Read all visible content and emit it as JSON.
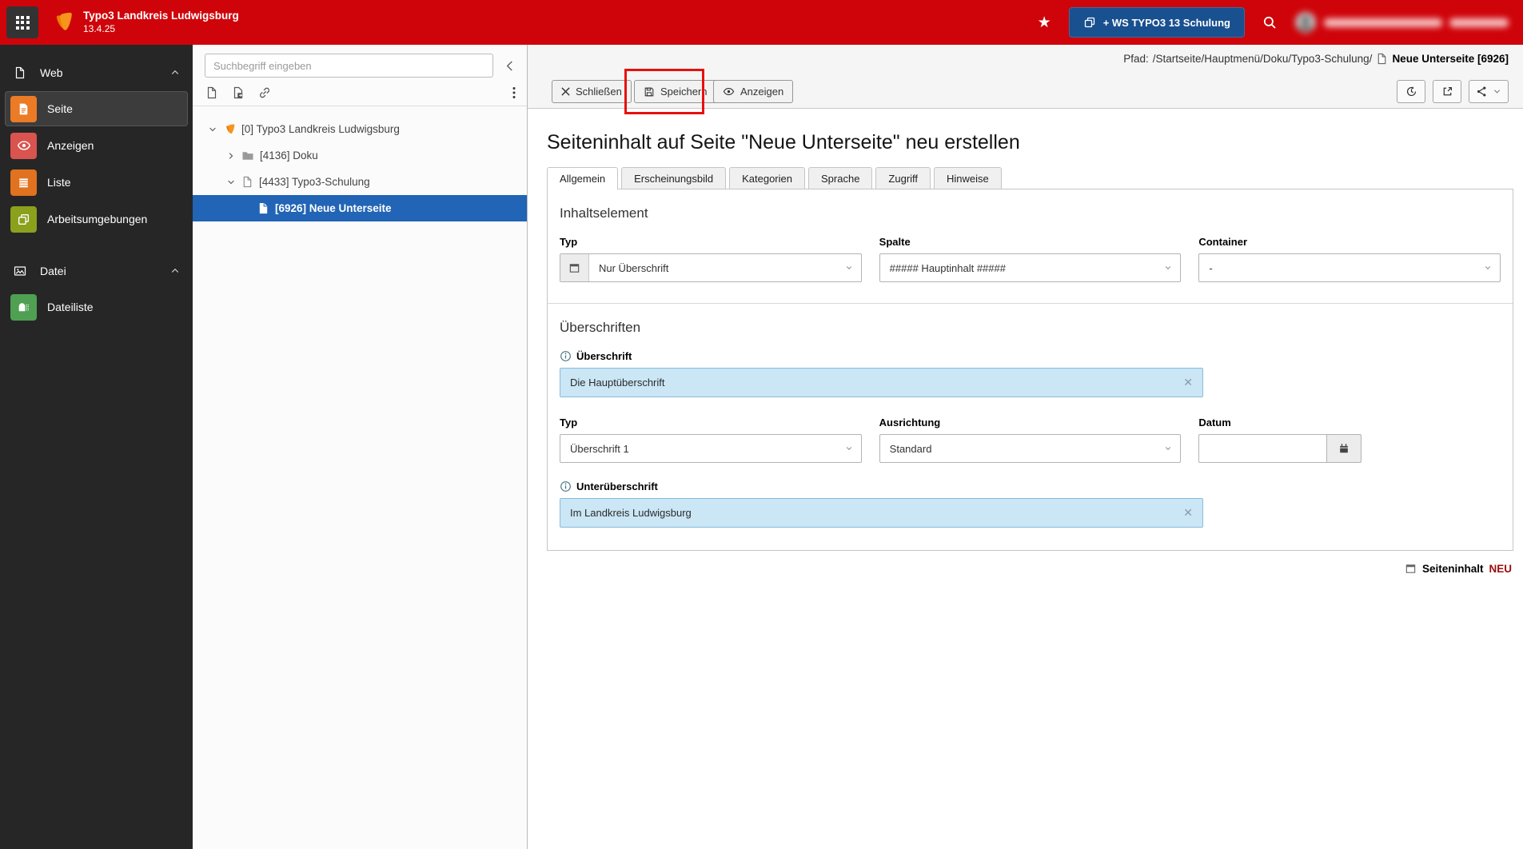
{
  "colors": {
    "topbar_red": "#cf040a",
    "workspace_button_blue": "#19508f",
    "tree_selection_blue": "#2264b5",
    "annotation_red": "#e8100c",
    "highlight_input_blue": "#cbe6f5",
    "badge_new_red": "#9b0c0c",
    "tile_orange": "#ec7b25",
    "tile_red": "#d9534f",
    "tile_olive": "#8ba01c",
    "tile_green": "#4fa052"
  },
  "topbar": {
    "app_title": "Typo3 Landkreis Ludwigsburg",
    "version": "13.4.25",
    "workspace_button_label": "+ WS TYPO3 13 Schulung"
  },
  "module_menu": {
    "sections": [
      {
        "label": "Web",
        "items": [
          {
            "label": "Seite"
          },
          {
            "label": "Anzeigen"
          },
          {
            "label": "Liste"
          },
          {
            "label": "Arbeitsumgebungen"
          }
        ]
      },
      {
        "label": "Datei",
        "items": [
          {
            "label": "Dateiliste"
          }
        ]
      }
    ]
  },
  "page_tree": {
    "search_placeholder": "Suchbegriff eingeben",
    "nodes": [
      {
        "label": "[0] Typo3 Landkreis Ludwigsburg"
      },
      {
        "label": "[4136] Doku"
      },
      {
        "label": "[4433] Typo3-Schulung"
      },
      {
        "label": "[6926] Neue Unterseite"
      }
    ]
  },
  "docheader": {
    "path_label": "Pfad:",
    "path_value": "/Startseite/Hauptmenü/Doku/Typo3-Schulung/",
    "record_title": "Neue Unterseite [6926]",
    "close_label": "Schließen",
    "save_label": "Speichern",
    "view_label": "Anzeigen"
  },
  "content": {
    "page_title": "Seiteninhalt auf Seite \"Neue Unterseite\" neu erstellen",
    "tabs": [
      {
        "label": "Allgemein"
      },
      {
        "label": "Erscheinungsbild"
      },
      {
        "label": "Kategorien"
      },
      {
        "label": "Sprache"
      },
      {
        "label": "Zugriff"
      },
      {
        "label": "Hinweise"
      }
    ],
    "inhaltselement": {
      "section_label": "Inhaltselement",
      "typ_label": "Typ",
      "typ_value": "Nur Überschrift",
      "spalte_label": "Spalte",
      "spalte_value": "##### Hauptinhalt #####",
      "container_label": "Container",
      "container_value": "-"
    },
    "ueberschriften": {
      "section_label": "Überschriften",
      "ueberschrift_label": "Überschrift",
      "ueberschrift_value": "Die Hauptüberschrift",
      "typ_label": "Typ",
      "typ_value": "Überschrift 1",
      "ausrichtung_label": "Ausrichtung",
      "ausrichtung_value": "Standard",
      "datum_label": "Datum",
      "datum_value": "",
      "unterueberschrift_label": "Unterüberschrift",
      "unterueberschrift_value": "Im Landkreis Ludwigsburg"
    },
    "footer_note": {
      "label": "Seiteninhalt",
      "badge": "NEU"
    }
  }
}
